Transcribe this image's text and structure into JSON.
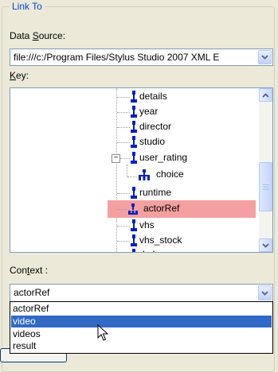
{
  "group": {
    "title": "Link To"
  },
  "data_source": {
    "label_pre": "Data ",
    "label_key": "S",
    "label_post": "ource:",
    "value": "file:///c:/Program Files/Stylus Studio 2007 XML E"
  },
  "key": {
    "label_pre": "",
    "label_key": "K",
    "label_post": "ey:"
  },
  "tree": {
    "items": [
      {
        "label": "details"
      },
      {
        "label": "year"
      },
      {
        "label": "director"
      },
      {
        "label": "studio"
      },
      {
        "label": "user_rating",
        "expander": "−"
      },
      {
        "label": "choice"
      },
      {
        "label": "runtime"
      },
      {
        "label": "actorRef"
      },
      {
        "label": "vhs"
      },
      {
        "label": "vhs_stock"
      },
      {
        "label": "dvd"
      }
    ],
    "selected": "actorRef"
  },
  "context": {
    "label_pre": "Con",
    "label_key": "t",
    "label_post": "ext :",
    "value": "actorRef",
    "options": [
      "actorRef",
      "video",
      "videos",
      "result"
    ],
    "highlighted": "video"
  },
  "colors": {
    "selection": "#f4a0a0",
    "highlight": "#316ac5",
    "title": "#0046d5"
  }
}
